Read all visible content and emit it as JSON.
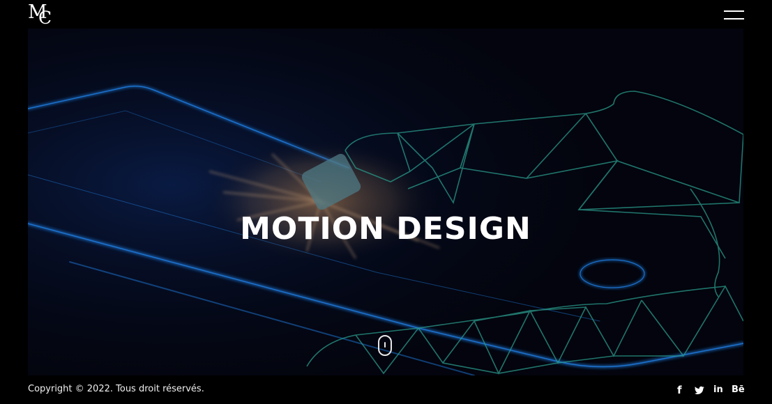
{
  "brand": {
    "logo_text": "MC",
    "logo_m": "M",
    "logo_c": "C"
  },
  "hero": {
    "title": "MOTION DESIGN"
  },
  "footer": {
    "copyright": "Copyright © 2022. Tous droit réservés.",
    "social": [
      {
        "icon": "facebook-icon",
        "glyph": "f"
      },
      {
        "icon": "twitter-icon",
        "glyph": ""
      },
      {
        "icon": "linkedin-icon",
        "glyph": "in"
      },
      {
        "icon": "behance-icon",
        "glyph": "Bē"
      }
    ]
  },
  "colors": {
    "page_background": "#000000",
    "hero_background": "#03040d",
    "neon_blue": "#1e78d8",
    "mesh_teal": "#2a9b8c",
    "splash_orange": "#c58a55",
    "text": "#ffffff"
  }
}
